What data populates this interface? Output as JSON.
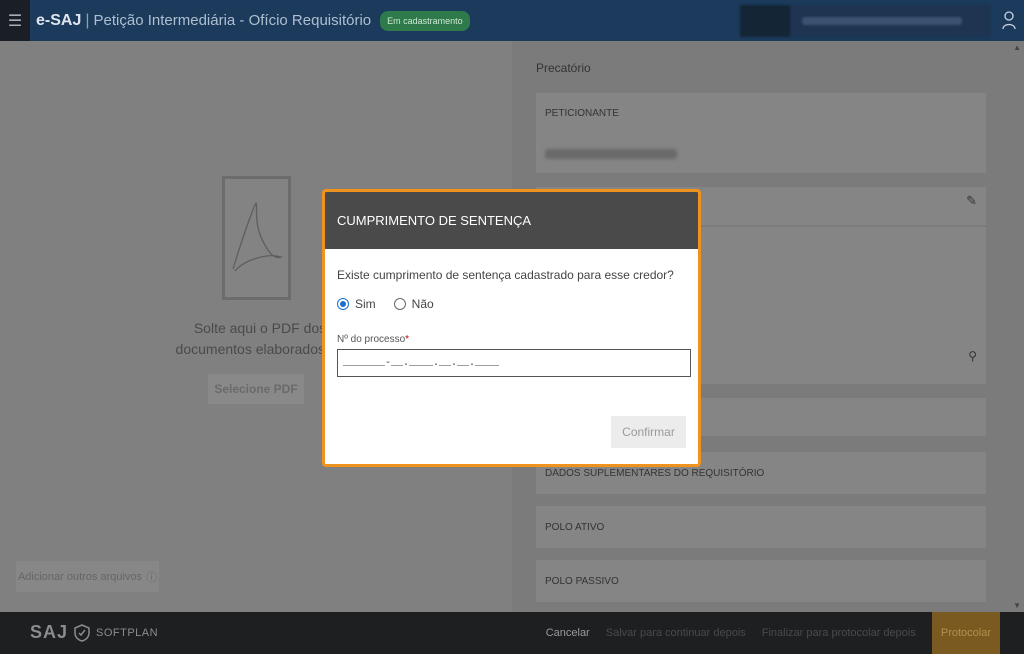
{
  "header": {
    "app_name": "e-SAJ",
    "separator": "|",
    "title": "Petição Intermediária - Ofício Requisitório",
    "status": "Em cadastramento"
  },
  "left": {
    "drop_text": "Solte aqui o PDF dos documentos elaborados ou",
    "select_pdf": "Selecione PDF",
    "add_files": "Adicionar outros arquivos"
  },
  "right": {
    "precatorio_label": "Precatório",
    "sections": {
      "peticionante": "PETICIONANTE",
      "dados_suplementares": "DADOS SUPLEMENTARES DO REQUISITÓRIO",
      "polo_ativo": "POLO ATIVO",
      "polo_passivo": "POLO PASSIVO"
    }
  },
  "modal": {
    "title": "CUMPRIMENTO DE SENTENÇA",
    "question": "Existe cumprimento de sentença cadastrado para esse credor?",
    "options": [
      "Sim",
      "Não"
    ],
    "selected": "Sim",
    "field_label": "Nº do processo",
    "required_mark": "*",
    "process_value": "_______-__.____.__.__.____",
    "confirm": "Confirmar"
  },
  "footer": {
    "logo_text": "SAJ",
    "logo_brand": "SOFTPLAN",
    "cancel": "Cancelar",
    "save_later": "Salvar para continuar depois",
    "finish_later": "Finalizar para protocolar depois",
    "protocolar": "Protocolar"
  },
  "colors": {
    "topbar": "#1b3a5c",
    "modal_border": "#f0921e",
    "modal_header": "#4a4a4a",
    "radio_selected": "#1a6fd1"
  }
}
